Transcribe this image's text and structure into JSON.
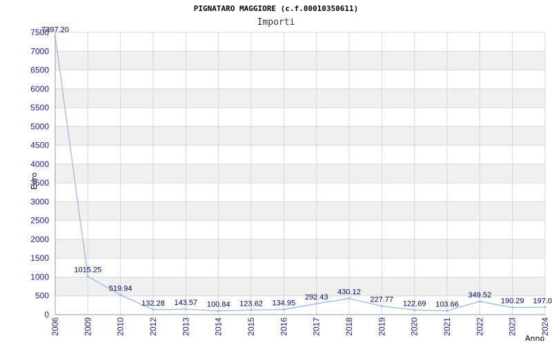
{
  "chart_data": {
    "type": "line",
    "title": "PIGNATARO MAGGIORE (c.f.80010350611)",
    "subtitle": "Importi",
    "xlabel": "Anno",
    "ylabel": "Euro",
    "categories": [
      "2006",
      "2009",
      "2010",
      "2012",
      "2013",
      "2014",
      "2015",
      "2016",
      "2017",
      "2018",
      "2019",
      "2020",
      "2021",
      "2022",
      "2023",
      "2024"
    ],
    "series": [
      {
        "values": [
          7397.2,
          1015.25,
          519.94,
          132.28,
          143.57,
          100.84,
          123.62,
          134.95,
          292.43,
          430.12,
          227.77,
          122.69,
          103.66,
          349.52,
          190.29,
          197.0
        ],
        "labels": [
          "7397.20",
          "1015.25",
          "519.94",
          "132.28",
          "143.57",
          "100.84",
          "123.62",
          "134.95",
          "292.43",
          "430.12",
          "227.77",
          "122.69",
          "103.66",
          "349.52",
          "190.29",
          "197.0"
        ]
      }
    ],
    "ylim": [
      0,
      7500
    ],
    "yticks": [
      "0",
      "500",
      "1000",
      "1500",
      "2000",
      "2500",
      "3000",
      "3500",
      "4000",
      "4500",
      "5000",
      "5500",
      "6000",
      "6500",
      "7000",
      "7500"
    ],
    "grid": true,
    "legend": "none",
    "colors": {
      "line": "#8ab8ec",
      "tick_label": "#1a1aa6",
      "data_label": "#000080",
      "band": "#f0f0f0",
      "grid": "#d8d8d8"
    }
  }
}
